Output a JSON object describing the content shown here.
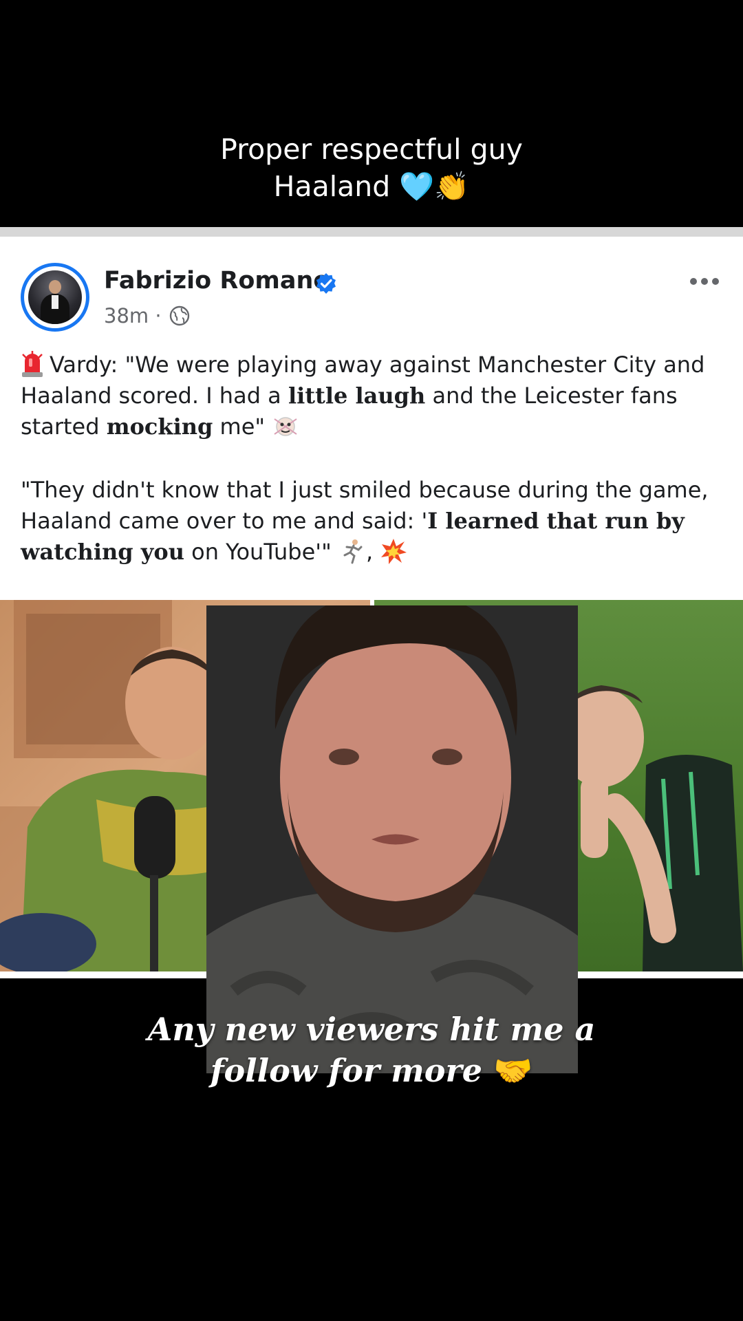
{
  "caption_top": {
    "line1": "Proper respectful guy",
    "line2": "Haaland",
    "emoji_heart": "🩵",
    "emoji_clap": "👏"
  },
  "post": {
    "author": "Fabrizio Romano",
    "time": "38m",
    "separator": "·",
    "verified_icon": "verified-badge-icon",
    "more_icon": "more-options-icon",
    "para1": {
      "t1": "Vardy: \"We were playing away against Manchester City and Haaland scored. I had a ",
      "b1": "little laugh",
      "t2": " and the Leicester fans started ",
      "b2": "mocking",
      "t3": " me\""
    },
    "para2": {
      "t1": "\"They didn't know that I just smiled because  during the game, Haaland came over to me and said: '",
      "b1": "I learned that run by watching you",
      "t2": " on YouTube'\""
    }
  },
  "caption_bottom": {
    "line1": "Any new viewers hit me a",
    "line2": "follow for more",
    "emoji_handshake": "🤝"
  },
  "colors": {
    "background": "#000000",
    "card": "#ffffff",
    "author": "#1c1e21",
    "meta": "#65676b",
    "verified": "#1877f2"
  }
}
